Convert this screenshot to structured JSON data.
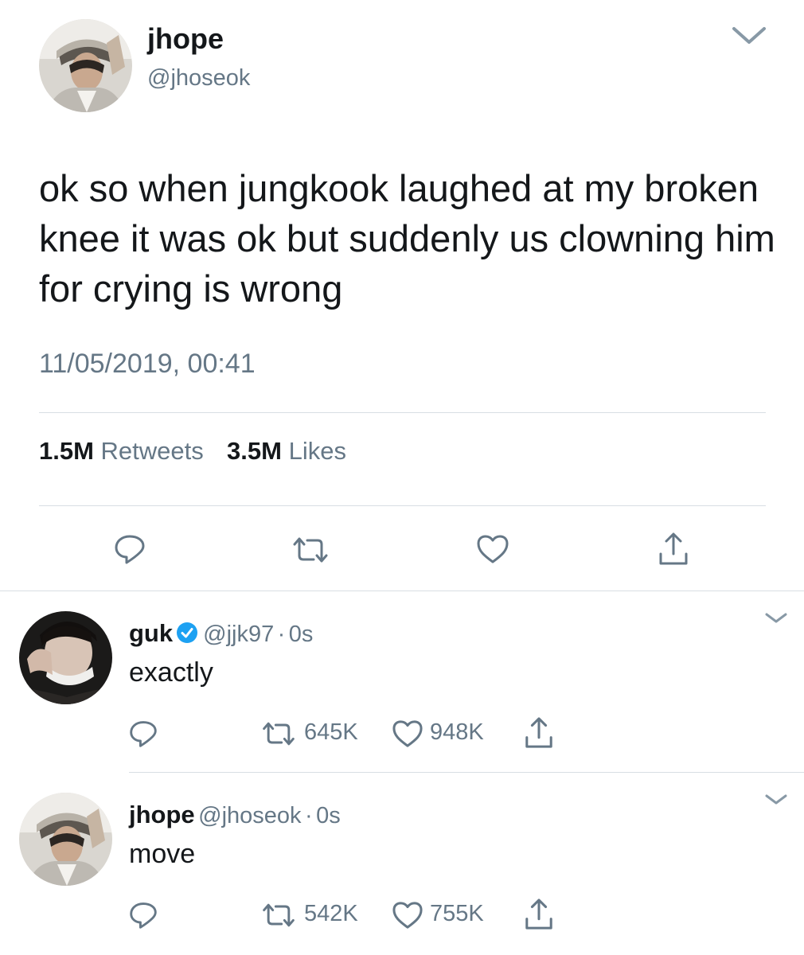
{
  "main_tweet": {
    "name": "jhope",
    "handle": "@jhoseok",
    "text": "ok so when jungkook laughed at my broken knee it was ok but suddenly us clowning him for crying is wrong",
    "timestamp": "11/05/2019, 00:41",
    "retweets_count": "1.5M",
    "retweets_label": "Retweets",
    "likes_count": "3.5M",
    "likes_label": "Likes",
    "actions": [
      "reply-icon",
      "retweet-icon",
      "heart-icon",
      "share-icon"
    ]
  },
  "replies": [
    {
      "name": "guk",
      "verified": true,
      "handle": "@jjk97",
      "separator": "·",
      "time": "0s",
      "text": "exactly",
      "retweets": "645K",
      "likes": "948K"
    },
    {
      "name": "jhope",
      "verified": false,
      "handle": "@jhoseok",
      "separator": "·",
      "time": "0s",
      "text": "move",
      "retweets": "542K",
      "likes": "755K"
    }
  ],
  "colors": {
    "text": "#14171a",
    "secondary": "#657786",
    "divider": "#d8dee3",
    "verified": "#1da1f2"
  }
}
